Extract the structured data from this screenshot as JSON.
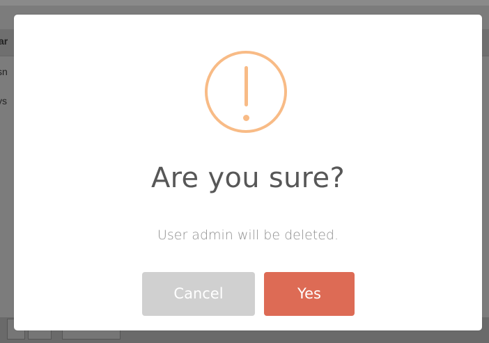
{
  "background": {
    "header_fragment": "ar",
    "row1_fragment": "sn",
    "row2_fragment": "ys"
  },
  "dialog": {
    "icon": "exclamation-icon",
    "title": "Are you sure?",
    "message": "User admin will be deleted.",
    "cancel_label": "Cancel",
    "confirm_label": "Yes"
  },
  "colors": {
    "icon": "#f8bb86",
    "confirm_button": "#dd6b55",
    "cancel_button": "#d0d0d0",
    "overlay": "#8a8a8a"
  }
}
